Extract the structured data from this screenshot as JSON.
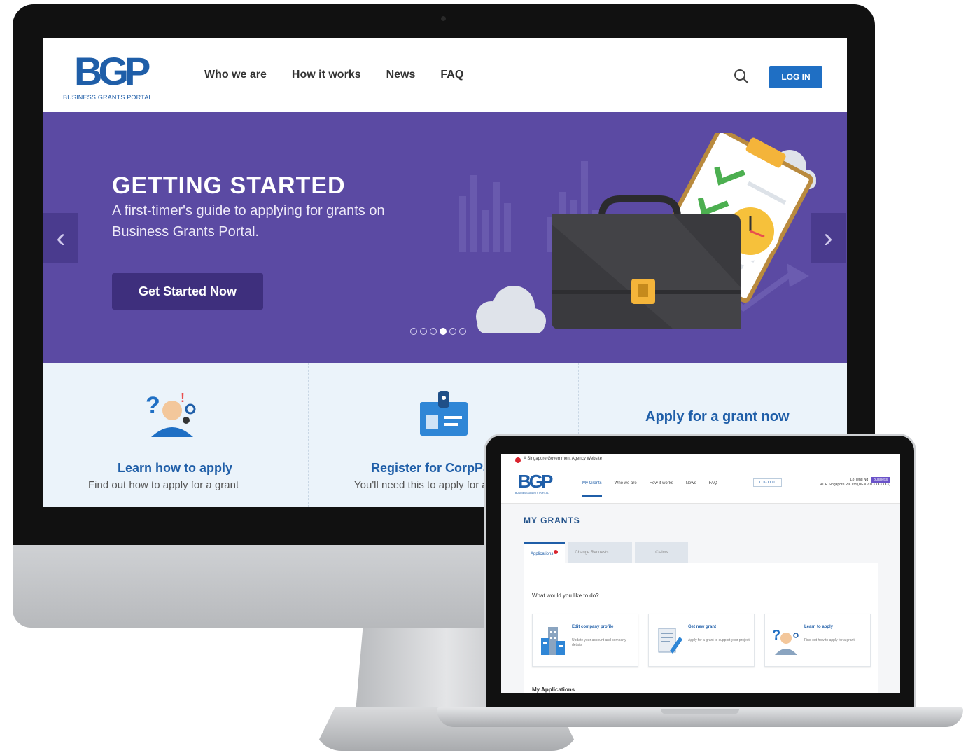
{
  "site": {
    "logo_mark": "BGP",
    "logo_sub": "BUSINESS GRANTS PORTAL",
    "nav": [
      "Who we are",
      "How it works",
      "News",
      "FAQ"
    ],
    "login_label": "LOG IN"
  },
  "hero": {
    "title": "GETTING STARTED",
    "subtitle": "A first-timer's guide to applying for grants on Business Grants Portal.",
    "cta_label": "Get Started Now",
    "prev_label": "‹",
    "next_label": "›",
    "slide_count": 6,
    "active_slide": 3
  },
  "features": [
    {
      "title": "Learn how to apply",
      "desc": "Find out how to apply for a grant",
      "icon": "person-question-icon"
    },
    {
      "title": "Register for CorpPass",
      "desc": "You'll need this to apply for a grant",
      "icon": "id-card-icon"
    }
  ],
  "apply_cta": "Apply for a grant now",
  "laptop": {
    "gov_text": "A Singapore Government Agency Website",
    "logo_mark": "BGP",
    "logo_sub": "BUSINESS GRANTS PORTAL",
    "nav": [
      "My Grants",
      "Who we are",
      "How it works",
      "News",
      "FAQ"
    ],
    "logout_label": "LOG OUT",
    "user_line1": "Lo Teng Ng",
    "user_badge": "Business",
    "user_line2": "ACE Singapore Pte Ltd (UEN 201XXXXXXX)",
    "page_title": "MY GRANTS",
    "tabs": [
      "Applications",
      "Change Requests",
      "Claims"
    ],
    "question": "What would you like to do?",
    "cards": [
      {
        "title": "Edit company profile",
        "desc": "Update your account and company details",
        "icon": "building-icon"
      },
      {
        "title": "Get new grant",
        "desc": "Apply for a grant to support your project",
        "icon": "document-pen-icon"
      },
      {
        "title": "Learn to apply",
        "desc": "Find out how to apply for a grant",
        "icon": "person-question-icon"
      }
    ],
    "section_label": "My Applications"
  },
  "colors": {
    "brand_blue": "#1f5ea8",
    "hero_purple": "#5b4aa3",
    "cta_purple": "#3e2f7d",
    "features_bg": "#ebf3fa"
  }
}
